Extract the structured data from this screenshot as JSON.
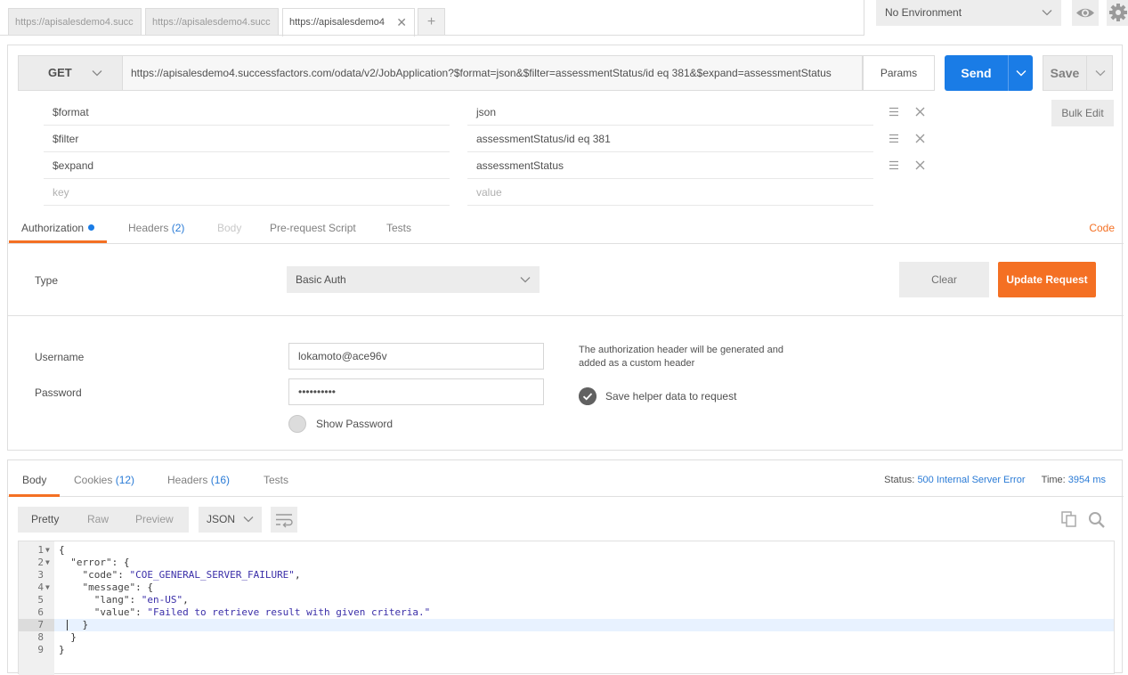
{
  "tabs": [
    {
      "label": "https://apisalesdemo4.succ",
      "active": false
    },
    {
      "label": "https://apisalesdemo4.succ",
      "active": false
    },
    {
      "label": "https://apisalesdemo4",
      "active": true
    }
  ],
  "tab_add_label": "+",
  "environment": {
    "selected": "No Environment"
  },
  "request": {
    "method": "GET",
    "url": "https://apisalesdemo4.successfactors.com/odata/v2/JobApplication?$format=json&$filter=assessmentStatus/id eq 381&$expand=assessmentStatus",
    "params_label": "Params",
    "send_label": "Send",
    "save_label": "Save"
  },
  "params": [
    {
      "key": "$format",
      "value": "json"
    },
    {
      "key": "$filter",
      "value": "assessmentStatus/id eq 381"
    },
    {
      "key": "$expand",
      "value": "assessmentStatus"
    }
  ],
  "params_placeholder": {
    "key": "key",
    "value": "value"
  },
  "bulk_edit_label": "Bulk Edit",
  "request_tabs": {
    "authorization": "Authorization",
    "headers": "Headers",
    "headers_count": "(2)",
    "body": "Body",
    "prerequest": "Pre-request Script",
    "tests": "Tests",
    "code": "Code"
  },
  "auth": {
    "type_label": "Type",
    "type_value": "Basic Auth",
    "clear_label": "Clear",
    "update_label": "Update Request",
    "username_label": "Username",
    "username_value": "lokamoto@ace96v",
    "password_label": "Password",
    "password_value": "••••••••••",
    "show_password_label": "Show Password",
    "note": "The authorization header will be generated and added as a custom header",
    "save_helper_label": "Save helper data to request"
  },
  "response_tabs": {
    "body": "Body",
    "cookies": "Cookies",
    "cookies_count": "(12)",
    "headers": "Headers",
    "headers_count": "(16)",
    "tests": "Tests"
  },
  "status": {
    "status_label": "Status:",
    "status_value": "500 Internal Server Error",
    "time_label": "Time:",
    "time_value": "3954 ms"
  },
  "format_buttons": {
    "pretty": "Pretty",
    "raw": "Raw",
    "preview": "Preview"
  },
  "json_select": "JSON",
  "code_lines": [
    {
      "n": "1",
      "fold": true,
      "text": "{"
    },
    {
      "n": "2",
      "fold": true,
      "text": "  \"error\": {"
    },
    {
      "n": "3",
      "fold": false,
      "text": "    \"code\": \"COE_GENERAL_SERVER_FAILURE\","
    },
    {
      "n": "4",
      "fold": true,
      "text": "    \"message\": {"
    },
    {
      "n": "5",
      "fold": false,
      "text": "      \"lang\": \"en-US\","
    },
    {
      "n": "6",
      "fold": false,
      "text": "      \"value\": \"Failed to retrieve result with given criteria.\""
    },
    {
      "n": "7",
      "fold": false,
      "text": "    }"
    },
    {
      "n": "8",
      "fold": false,
      "text": "  }"
    },
    {
      "n": "9",
      "fold": false,
      "text": "}"
    }
  ],
  "colors": {
    "send": "#1a7ce6",
    "accent": "#f47023",
    "link": "#2a7bd6"
  }
}
